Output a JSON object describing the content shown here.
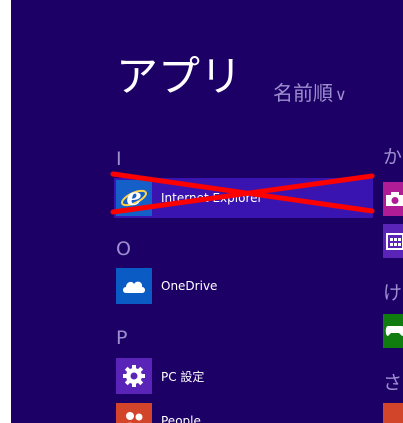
{
  "header": {
    "title": "アプリ",
    "sort_label": "名前順",
    "sort_chevron": "∨"
  },
  "groups": {
    "i": {
      "letter": "I"
    },
    "o": {
      "letter": "O"
    },
    "p": {
      "letter": "P"
    }
  },
  "apps": {
    "ie": {
      "name": "Internet Explorer",
      "icon": "internet-explorer-icon",
      "color": "#1460c8"
    },
    "onedrive": {
      "name": "OneDrive",
      "icon": "cloud-icon",
      "color": "#0a5bc4"
    },
    "pc_settings": {
      "name": "PC 設定",
      "icon": "gear-icon",
      "color": "#5a24b8"
    },
    "people": {
      "name": "People",
      "icon": "people-icon",
      "color": "#d2452a"
    }
  },
  "right_column": {
    "group_ka": "か",
    "group_ke": "け",
    "group_sa": "さ",
    "tiles": [
      {
        "icon": "camera-icon",
        "color": "#b01c96"
      },
      {
        "icon": "calendar-icon",
        "color": "#5a24b8"
      },
      {
        "icon": "xbox-games-icon",
        "color": "#107c10"
      },
      {
        "icon": "app-icon",
        "color": "#d2452a"
      }
    ]
  },
  "colors": {
    "background": "#1d0066",
    "selection": "#3a14b0",
    "annotation_cross": "#ff0000"
  }
}
